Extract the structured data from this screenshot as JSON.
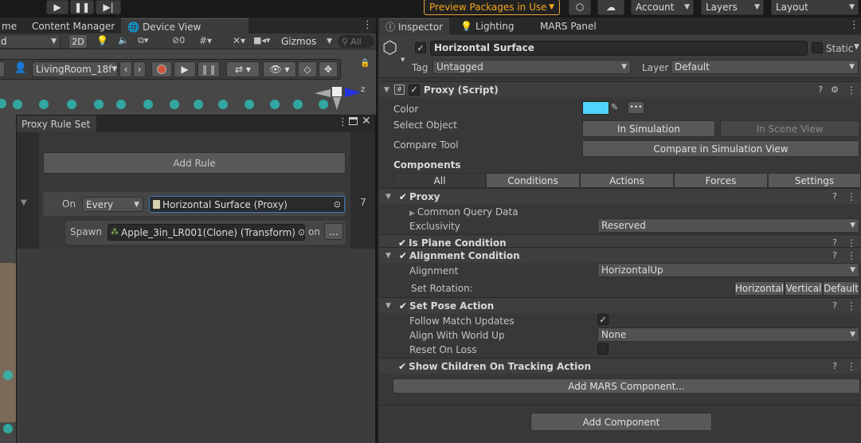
{
  "toolbar": {
    "preview_packages": "Preview Packages in Use",
    "account": "Account",
    "layers": "Layers",
    "layout": "Layout"
  },
  "left_tabs": {
    "tab_partial": "me",
    "content_manager": "Content Manager",
    "device_view": "Device View"
  },
  "scene_toolbar": {
    "shading_partial": "d",
    "mode_2d": "2D",
    "hidden_count": "0",
    "gizmos": "Gizmos",
    "search_placeholder": "All"
  },
  "sim_bar": {
    "environment": "LivingRoom_18f"
  },
  "gizmo": {
    "axis_z": "z"
  },
  "proxy_rule_set": {
    "title": "Proxy Rule Set",
    "add_rule": "Add Rule",
    "on_label": "On",
    "every": "Every",
    "target": "Horizontal Surface (Proxy)",
    "count": "7",
    "spawn_label": "Spawn",
    "spawn_target": "Apple_3in_LR001(Clone) (Transform)",
    "on2": "on",
    "more": "..."
  },
  "right_tabs": {
    "inspector": "Inspector",
    "lighting": "Lighting",
    "mars_panel": "MARS Panel"
  },
  "inspector": {
    "object_name": "Horizontal Surface",
    "static_label": "Static",
    "tag_label": "Tag",
    "tag_value": "Untagged",
    "layer_label": "Layer",
    "layer_value": "Default",
    "script_title": "Proxy (Script)",
    "color_label": "Color",
    "color_value": "#4fd3ff",
    "select_object_label": "Select Object",
    "in_simulation": "In Simulation",
    "in_scene_view": "In Scene View",
    "compare_tool_label": "Compare Tool",
    "compare_button": "Compare in Simulation View",
    "components_label": "Components",
    "component_tabs": [
      "All",
      "Conditions",
      "Actions",
      "Forces",
      "Settings"
    ],
    "proxy": {
      "title": "Proxy",
      "common_query": "Common Query Data",
      "exclusivity_label": "Exclusivity",
      "exclusivity_value": "Reserved"
    },
    "is_plane": {
      "title": "Is Plane Condition"
    },
    "alignment": {
      "title": "Alignment Condition",
      "alignment_label": "Alignment",
      "alignment_value": "HorizontalUp",
      "set_rotation_label": "Set Rotation:",
      "rot_horizontal": "Horizontal",
      "rot_vertical": "Vertical",
      "rot_default": "Default"
    },
    "set_pose": {
      "title": "Set Pose Action",
      "follow_label": "Follow Match Updates",
      "align_label": "Align With World Up",
      "align_value": "None",
      "reset_label": "Reset On Loss"
    },
    "show_children": {
      "title": "Show Children On Tracking Action"
    },
    "add_mars": "Add MARS Component...",
    "add_component": "Add Component"
  }
}
